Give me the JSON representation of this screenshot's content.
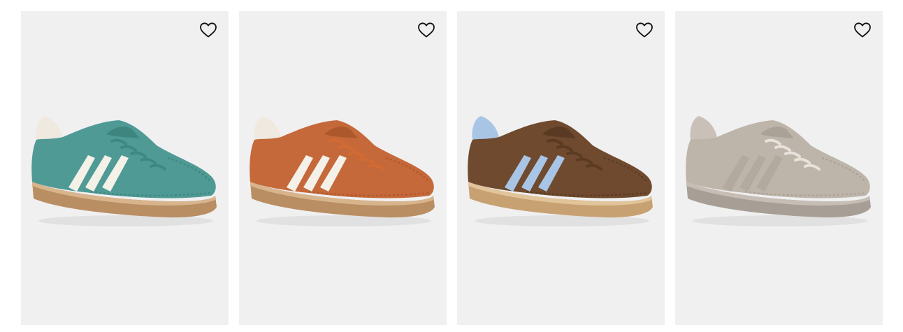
{
  "products": [
    {
      "icon": "heart-outline-icon",
      "colors": {
        "upper": "#4f9a95",
        "upper_dark": "#3e8580",
        "stripe": "#f4f1e8",
        "sole": "#b98e63",
        "sole_light": "#d8b48c",
        "lace": "#3f8782",
        "collar": "#efe9df"
      }
    },
    {
      "icon": "heart-outline-icon",
      "colors": {
        "upper": "#c5693a",
        "upper_dark": "#ad582c",
        "stripe": "#f4f1e8",
        "sole": "#b98e63",
        "sole_light": "#d8b48c",
        "lace": "#d26a33",
        "collar": "#efe9df"
      }
    },
    {
      "icon": "heart-outline-icon",
      "colors": {
        "upper": "#6f4a2e",
        "upper_dark": "#5a3a22",
        "stripe": "#a9c5e6",
        "sole": "#c8a172",
        "sole_light": "#e1c49a",
        "lace": "#5b3a22",
        "collar": "#a9c5e6"
      }
    },
    {
      "icon": "heart-outline-icon",
      "colors": {
        "upper": "#bdb4aa",
        "upper_dark": "#aaa197",
        "stripe": "#b2a99f",
        "sole": "#a79f96",
        "sole_light": "#c6beb5",
        "lace": "#e7e2dc",
        "collar": "#c9c1b8"
      }
    }
  ]
}
